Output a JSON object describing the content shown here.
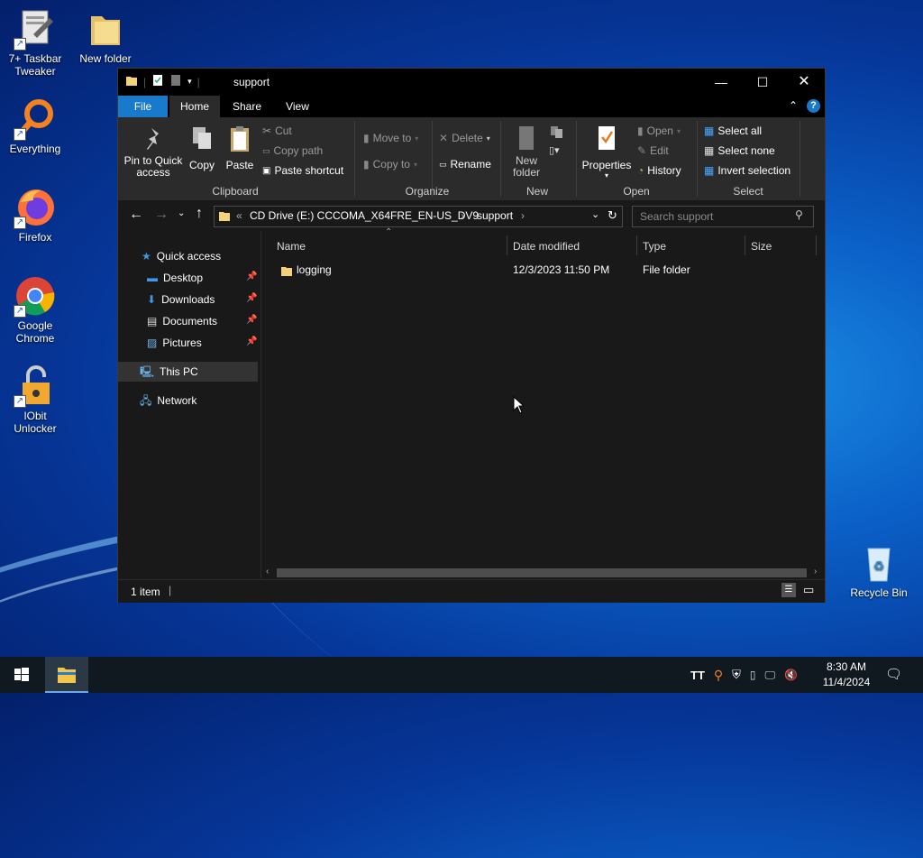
{
  "desktop": {
    "icons": [
      {
        "label": "7+ Taskbar Tweaker"
      },
      {
        "label": "New folder"
      },
      {
        "label": "Everything"
      },
      {
        "label": "Firefox"
      },
      {
        "label": "Google Chrome"
      },
      {
        "label": "IObit Unlocker"
      },
      {
        "label": "Recycle Bin"
      }
    ]
  },
  "window": {
    "title": "support",
    "tabs": [
      "File",
      "Home",
      "Share",
      "View"
    ],
    "ribbon": {
      "clipboard": {
        "pin": "Pin to Quick access",
        "copy": "Copy",
        "paste": "Paste",
        "cut": "Cut",
        "copy_path": "Copy path",
        "paste_shortcut": "Paste shortcut",
        "group": "Clipboard"
      },
      "organize": {
        "move_to": "Move to",
        "copy_to": "Copy to",
        "delete": "Delete",
        "rename": "Rename",
        "group": "Organize"
      },
      "new": {
        "new_folder": "New folder",
        "group": "New"
      },
      "open": {
        "properties": "Properties",
        "open": "Open",
        "edit": "Edit",
        "history": "History",
        "group": "Open"
      },
      "select": {
        "select_all": "Select all",
        "select_none": "Select none",
        "invert": "Invert selection",
        "group": "Select"
      }
    },
    "address": {
      "prefix": "«",
      "segments": [
        "CD Drive (E:) CCCOMA_X64FRE_EN-US_DV9",
        "support"
      ],
      "search_placeholder": "Search support"
    },
    "nav": {
      "quick_access": "Quick access",
      "items": [
        "Desktop",
        "Downloads",
        "Documents",
        "Pictures"
      ],
      "this_pc": "This PC",
      "network": "Network"
    },
    "columns": [
      "Name",
      "Date modified",
      "Type",
      "Size"
    ],
    "files": [
      {
        "name": "logging",
        "date": "12/3/2023 11:50 PM",
        "type": "File folder",
        "size": ""
      }
    ],
    "status": "1 item"
  },
  "taskbar": {
    "time": "8:30 AM",
    "date": "11/4/2024"
  },
  "colors": {
    "accent": "#1979ca",
    "window_bg": "#191919",
    "ribbon_bg": "#2b2b2b"
  }
}
